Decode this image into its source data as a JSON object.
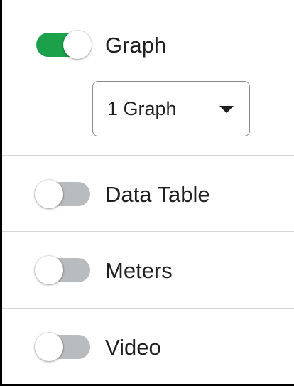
{
  "colors": {
    "toggle_on": "#1aa14a",
    "toggle_off": "#b9bcbf",
    "divider": "#d6d6d6"
  },
  "options": [
    {
      "label": "Graph",
      "enabled": true
    },
    {
      "label": "Data Table",
      "enabled": false
    },
    {
      "label": "Meters",
      "enabled": false
    },
    {
      "label": "Video",
      "enabled": false
    }
  ],
  "graph_count_select": {
    "selected": "1 Graph",
    "icon": "caret-down-icon"
  }
}
